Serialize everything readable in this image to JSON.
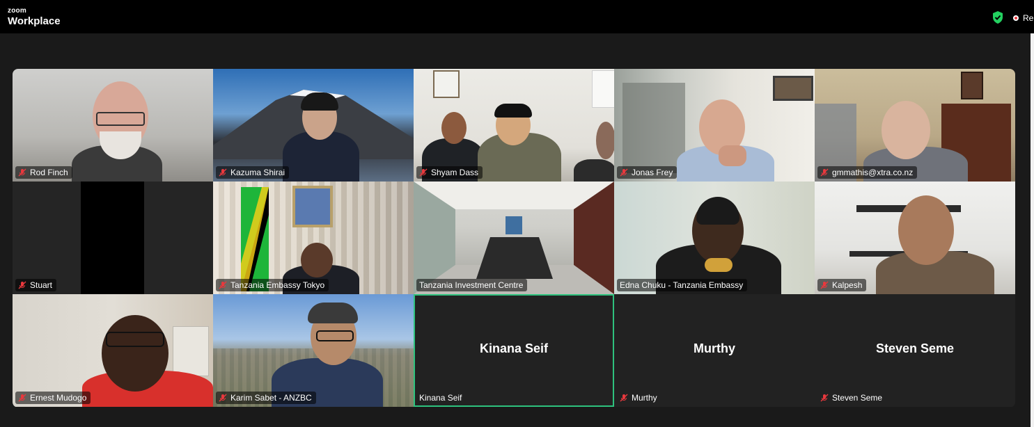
{
  "app": {
    "brand_small": "zoom",
    "brand_big": "Workplace",
    "recording_label": "Re"
  },
  "colors": {
    "topbar": "#000000",
    "stage": "#1a1a1a",
    "active_speaker": "#2ec27e",
    "muted": "#e8383d"
  },
  "participants": [
    {
      "name": "Rod Finch",
      "muted": true
    },
    {
      "name": "Kazuma Shirai",
      "muted": true
    },
    {
      "name": "Shyam Dass",
      "muted": true
    },
    {
      "name": "Jonas Frey",
      "muted": true
    },
    {
      "name": "gmmathis@xtra.co.nz",
      "muted": true
    },
    {
      "name": "Stuart",
      "muted": true
    },
    {
      "name": "Tanzania Embassy Tokyo",
      "muted": true
    },
    {
      "name": "Tanzania Investment Centre",
      "muted": false
    },
    {
      "name": "Edna Chuku - Tanzania Embassy",
      "muted": false
    },
    {
      "name": "Kalpesh",
      "muted": true
    },
    {
      "name": "Ernest Mudogo",
      "muted": true
    },
    {
      "name": "Karim Sabet - ANZBC",
      "muted": true
    },
    {
      "name": "Kinana Seif",
      "muted": false,
      "video_off": true,
      "active": true
    },
    {
      "name": "Murthy",
      "muted": true,
      "video_off": true
    },
    {
      "name": "Steven Seme",
      "muted": true,
      "video_off": true
    }
  ]
}
